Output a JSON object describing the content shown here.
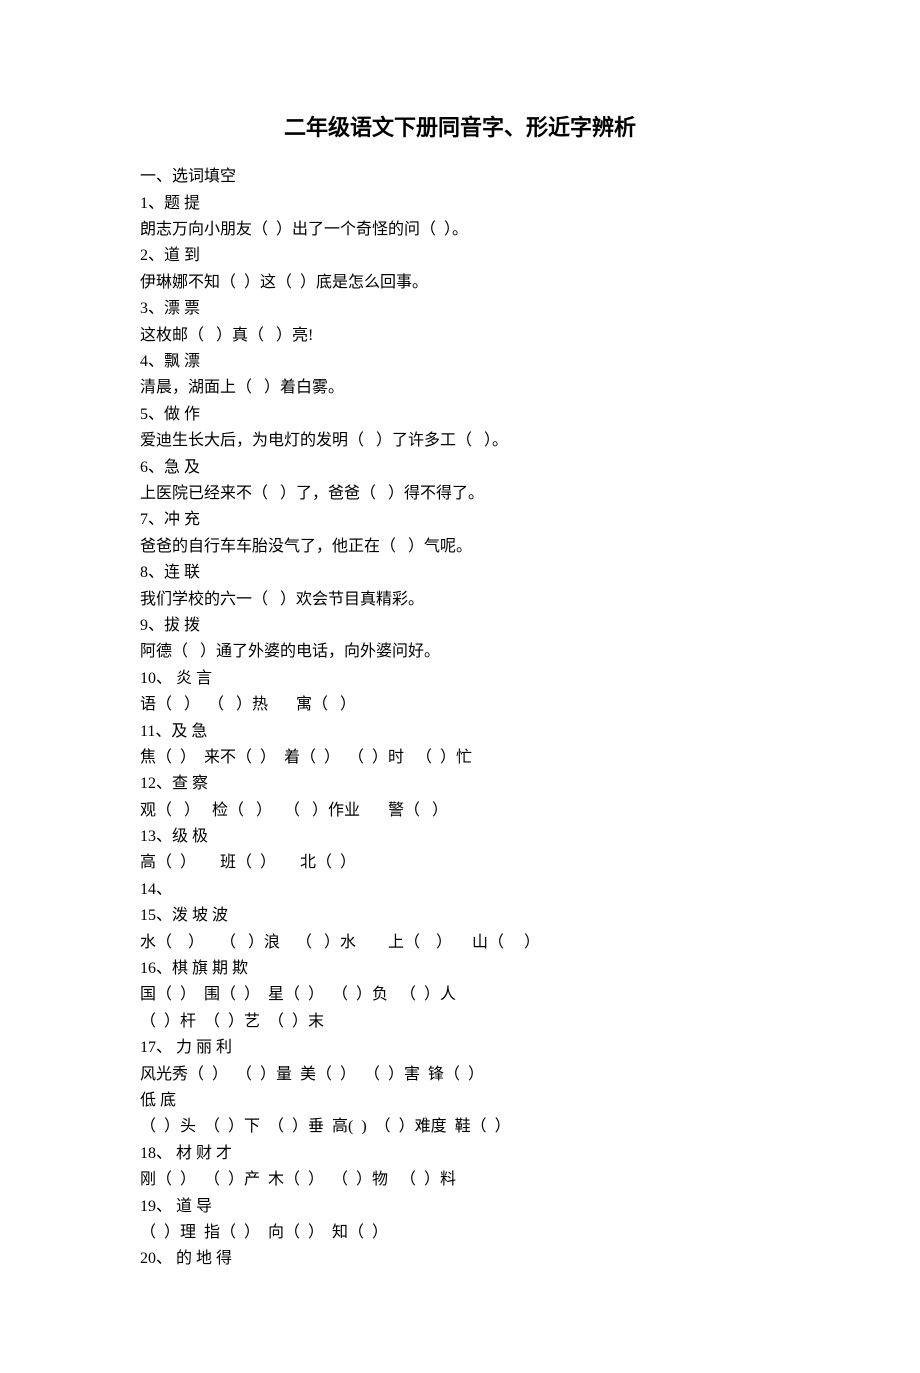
{
  "title": "二年级语文下册同音字、形近字辨析",
  "section_heading": "一、选词填空",
  "items": [
    {
      "num": "1、",
      "label": "题 提",
      "sentences": [
        "朗志万向小朋友（  ）出了一个奇怪的问（  ）。"
      ]
    },
    {
      "num": "2、",
      "label": "道 到",
      "sentences": [
        "伊琳娜不知（  ）这（  ）底是怎么回事。"
      ]
    },
    {
      "num": "3、",
      "label": "漂 票",
      "sentences": [
        "这枚邮（   ）真（   ）亮!"
      ]
    },
    {
      "num": "4、",
      "label": "飘 漂",
      "sentences": [
        "清晨，湖面上（   ）着白雾。"
      ]
    },
    {
      "num": "5、",
      "label": "做 作",
      "sentences": [
        "爱迪生长大后，为电灯的发明（   ）了许多工（   ）。"
      ]
    },
    {
      "num": "6、",
      "label": "急 及",
      "sentences": [
        "上医院已经来不（   ）了，爸爸（   ）得不得了。"
      ]
    },
    {
      "num": "7、",
      "label": "冲 充",
      "sentences": [
        "爸爸的自行车车胎没气了，他正在（   ）气呢。"
      ]
    },
    {
      "num": "8、",
      "label": "连 联",
      "sentences": [
        "我们学校的六一（   ）欢会节目真精彩。"
      ]
    },
    {
      "num": "9、",
      "label": "拔 拨",
      "sentences": [
        "阿德（   ）通了外婆的电话，向外婆问好。"
      ]
    },
    {
      "num": "10、",
      "label": " 炎 言",
      "sentences": [
        "语（   ）  （   ）热       寓（   ）"
      ]
    },
    {
      "num": "11、",
      "label": "及 急",
      "sentences": [
        "焦（  ）  来不（  ）  着（  ）  （  ）时   （  ）忙"
      ]
    },
    {
      "num": "12、",
      "label": "查 察",
      "sentences": [
        "观（   ）   检（   ）   （   ）作业       警（   ）"
      ]
    },
    {
      "num": "13、",
      "label": "级 极",
      "sentences": [
        "高（  ）      班（  ）      北（  ）"
      ]
    },
    {
      "num": "14、",
      "label": "",
      "sentences": []
    },
    {
      "num": "15、",
      "label": "泼 坡 波",
      "sentences": [
        "水（    ）    （   ）浪    （   ）水        上（    ）     山（     ）"
      ]
    },
    {
      "num": "16、",
      "label": "棋 旗 期 欺",
      "sentences": [
        "国（  ）  围（  ）  星（  ）  （  ）负   （  ）人",
        "（  ）杆  （  ）艺  （  ）末"
      ]
    },
    {
      "num": "17、",
      "label": " 力 丽 利",
      "sentences": [
        "风光秀（  ）  （  ）量  美（  ）  （  ）害  锋（  ）",
        "低 底",
        "（  ）头  （  ）下  （  ）垂  高(  )  （  ）难度  鞋（  ）"
      ]
    },
    {
      "num": "18、",
      "label": " 材 财 才",
      "sentences": [
        "刚（  ）  （  ）产  木（  ）  （  ）物   （  ）料"
      ]
    },
    {
      "num": "19、",
      "label": " 道 导",
      "sentences": [
        "（  ）理  指（  ）  向（  ）  知（  ）"
      ]
    },
    {
      "num": "20、",
      "label": " 的 地 得",
      "sentences": []
    }
  ]
}
